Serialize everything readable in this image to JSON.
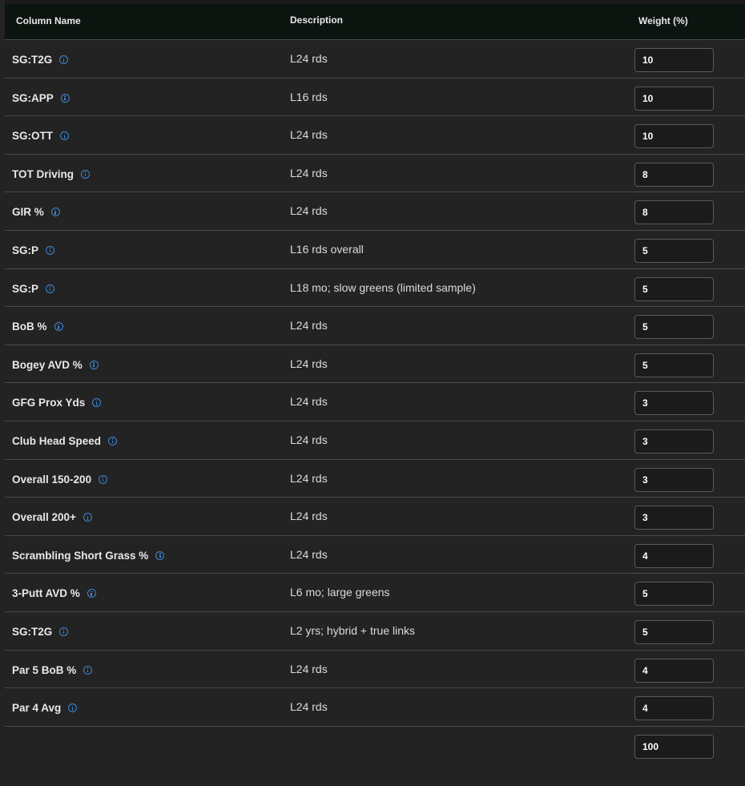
{
  "columns": {
    "name": "Column Name",
    "description": "Description",
    "weight": "Weight (%)"
  },
  "rows": [
    {
      "name": "SG:T2G",
      "description": "L24 rds",
      "weight": "10"
    },
    {
      "name": "SG:APP",
      "description": "L16 rds",
      "weight": "10"
    },
    {
      "name": "SG:OTT",
      "description": "L24 rds",
      "weight": "10"
    },
    {
      "name": "TOT Driving",
      "description": "L24 rds",
      "weight": "8"
    },
    {
      "name": "GIR %",
      "description": "L24 rds",
      "weight": "8"
    },
    {
      "name": "SG:P",
      "description": "L16 rds overall",
      "weight": "5"
    },
    {
      "name": "SG:P",
      "description": "L18 mo; slow greens (limited sample)",
      "weight": "5"
    },
    {
      "name": "BoB %",
      "description": "L24 rds",
      "weight": "5"
    },
    {
      "name": "Bogey AVD %",
      "description": "L24 rds",
      "weight": "5"
    },
    {
      "name": "GFG Prox Yds",
      "description": "L24 rds",
      "weight": "3"
    },
    {
      "name": "Club Head Speed",
      "description": "L24 rds",
      "weight": "3"
    },
    {
      "name": "Overall 150-200",
      "description": "L24 rds",
      "weight": "3"
    },
    {
      "name": "Overall 200+",
      "description": "L24 rds",
      "weight": "3"
    },
    {
      "name": "Scrambling Short Grass %",
      "description": "L24 rds",
      "weight": "4"
    },
    {
      "name": "3-Putt AVD %",
      "description": "L6 mo; large greens",
      "weight": "5"
    },
    {
      "name": "SG:T2G",
      "description": "L2 yrs; hybrid + true links",
      "weight": "5"
    },
    {
      "name": "Par 5 BoB %",
      "description": "L24 rds",
      "weight": "4"
    },
    {
      "name": "Par 4 Avg",
      "description": "L24 rds",
      "weight": "4"
    }
  ],
  "total": "100",
  "icons": {
    "info": "info-circle-icon"
  },
  "colors": {
    "background": "#232323",
    "header": "#0c1410",
    "accent": "#3d86d6"
  }
}
